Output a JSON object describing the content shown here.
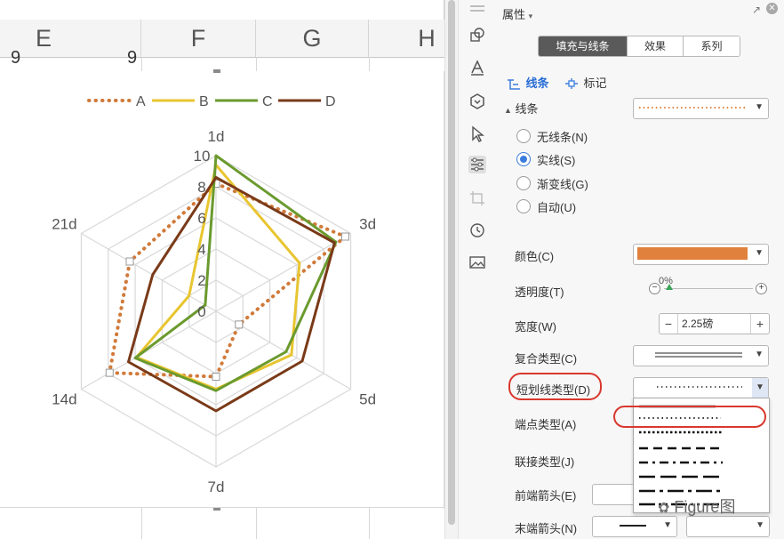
{
  "spreadsheet": {
    "columns": [
      "E",
      "F",
      "G",
      "H"
    ],
    "row_values": [
      "9",
      "9"
    ]
  },
  "chart_data": {
    "type": "radar",
    "categories": [
      "1d",
      "3d",
      "5d",
      "7d",
      "14d",
      "21d"
    ],
    "radial_ticks": [
      "0",
      "2",
      "4",
      "6",
      "8",
      "10"
    ],
    "rmax": 10,
    "series": [
      {
        "name": "A",
        "values": [
          8.2,
          9.6,
          1.7,
          4.2,
          7.9,
          6.4
        ],
        "color": "#d17a3a",
        "style": "dotted"
      },
      {
        "name": "B",
        "values": [
          9.4,
          6.2,
          5.6,
          5.0,
          5.9,
          2.0
        ],
        "color": "#e8c530",
        "style": "solid"
      },
      {
        "name": "C",
        "values": [
          10.0,
          8.9,
          5.2,
          5.1,
          6.0,
          0.8
        ],
        "color": "#6b9a2e",
        "style": "solid"
      },
      {
        "name": "D",
        "values": [
          8.6,
          8.8,
          6.4,
          6.4,
          6.5,
          4.7
        ],
        "color": "#7a3a18",
        "style": "solid"
      }
    ],
    "legend_position": "top",
    "grid": true
  },
  "rail": {
    "icons": [
      "shapes-icon",
      "text-style-icon",
      "shape-fill-icon",
      "select-pointer-icon",
      "properties-icon",
      "crop-icon",
      "history-icon",
      "image-icon"
    ]
  },
  "panel": {
    "title": "属性",
    "tabs": [
      {
        "label": "填充与线条",
        "active": true
      },
      {
        "label": "效果",
        "active": false
      },
      {
        "label": "系列",
        "active": false
      }
    ],
    "subtabs": {
      "line": "线条",
      "marker": "标记"
    },
    "section_line": "线条",
    "radio_options": [
      {
        "label": "无线条(N)",
        "checked": false
      },
      {
        "label": "实线(S)",
        "checked": true
      },
      {
        "label": "渐变线(G)",
        "checked": false
      },
      {
        "label": "自动(U)",
        "checked": false
      }
    ],
    "color_label": "颜色(C)",
    "color_value": "#e0813d",
    "transparency_label": "透明度(T)",
    "transparency_value": "0%",
    "width_label": "宽度(W)",
    "width_value": "2.25磅",
    "compound_label": "复合类型(C)",
    "dash_label": "短划线类型(D)",
    "cap_label": "端点类型(A)",
    "join_label": "联接类型(J)",
    "begin_arrow_label": "前端箭头(E)",
    "end_arrow_label": "末端箭头(N)",
    "watermark": "Figure图"
  }
}
